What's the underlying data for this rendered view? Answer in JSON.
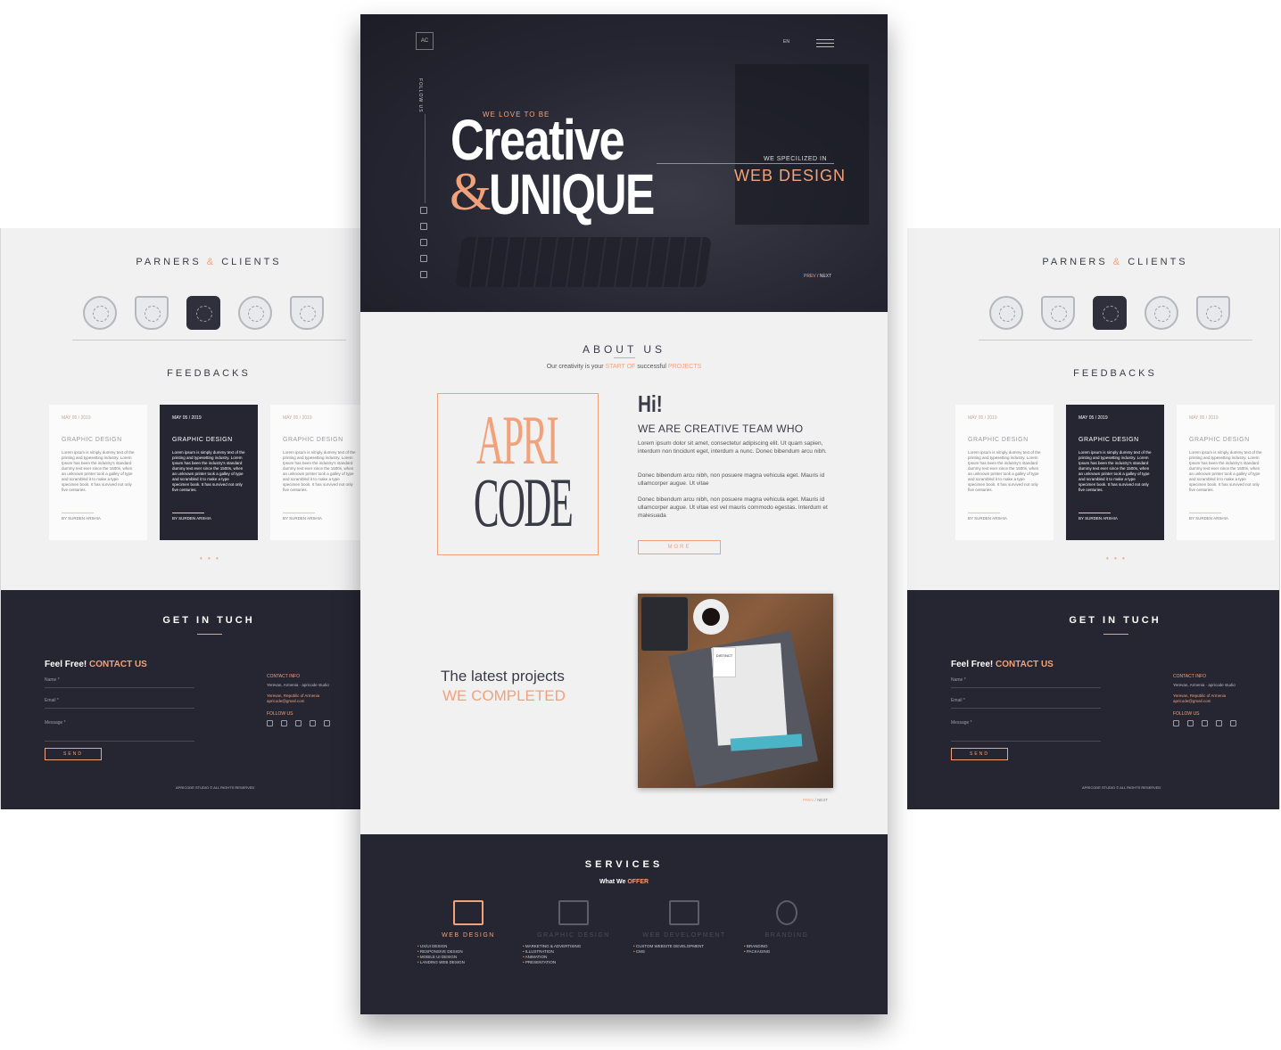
{
  "side": {
    "partners_title": "PARNERS",
    "partners_amp": "&",
    "partners_title2": "CLIENTS",
    "feedbacks_title": "FEEDBACKS",
    "cards": [
      {
        "date": "MAY 05 / 2019",
        "title": "GRAPHIC DESIGN",
        "text": "Lorem ipsum is simply dummy text of the printing and typesetting industry. Lorem Ipsum has been the industry's standard dummy text ever since the 1500s, when an unknown printer took a galley of type and scrambled it to make a type specimen book. It has survived not only five centuries.",
        "author": "BY SURDEN ARSHIA"
      },
      {
        "date": "MAY 05 / 2019",
        "title": "GRAPHIC DESIGN",
        "text": "Lorem ipsum is simply dummy text of the printing and typesetting industry. Lorem Ipsum has been the industry's standard dummy text ever since the 1500s, when an unknown printer took a galley of type and scrambled it to make a type specimen book. It has survived not only five centuries.",
        "author": "BY SURDEN ARSHIA"
      },
      {
        "date": "MAY 05 / 2019",
        "title": "GRAPHIC DESIGN",
        "text": "Lorem ipsum is simply dummy text of the printing and typesetting industry. Lorem Ipsum has been the industry's standard dummy text ever since the 1500s, when an unknown printer took a galley of type and scrambled it to make a type specimen book. It has survived not only five centuries.",
        "author": "BY SURDEN ARSHIA"
      }
    ],
    "dots": "• • •",
    "get_in_touch": "GET IN TUCH",
    "feel_free": "Feel Free!",
    "contact_us": "CONTACT US",
    "name_label": "Name *",
    "email_label": "Email *",
    "message_label": "Message *",
    "send": "SEND",
    "contact_info_label": "CONTACT INFO",
    "contact_info_text": "Yerevan, Armenia · apricode studio",
    "address": "Yerevan, Republic of Armenia",
    "email": "apricode@gmail.com",
    "follow_label": "FOLLOW US",
    "copyright": "APRICODE STUDIO © ALL RIGHTS RESERVED"
  },
  "hero": {
    "logo": "AC",
    "lang": "EN",
    "follow_us": "FOLLOW US",
    "we_love": "WE LOVE TO BE",
    "creative": "Creative",
    "amp": "&",
    "unique": "UNIQUE",
    "we_spec": "WE SPECILIZED IN",
    "web_design": "WEB DESIGN",
    "prev": "PREV",
    "sep": "/",
    "next": "NEXT"
  },
  "about": {
    "title": "ABOUT US",
    "sub_a": "Our creativity is your",
    "sub_b": "START OF",
    "sub_c": "successful",
    "sub_d": "PROJECTS",
    "brand_top": "APRI",
    "brand_bottom": "CODE",
    "hi": "Hi!",
    "team": "WE ARE CREATIVE TEAM WHO",
    "p1": "Lorem ipsum dolor sit amet, consectetur adipiscing elit. Ut quam sapien, interdum non tincidunt eget, interdum a nunc. Donec bibendum arcu nibh.",
    "p2": "Donec bibendum arcu nibh, non posuere magna vehicula eget. Mauris id ullamcorper augue. Ut vitae",
    "p3": "Donec bibendum arcu nibh, non posuere magna vehicula eget. Mauris id ullamcorper augue. Ut vitae est vel mauris commodo egestas. Interdum et malesuada",
    "more": "MORE",
    "latest": "The latest projects",
    "completed": "WE COMPLETED",
    "proj_prev": "PREV",
    "proj_sep": "/",
    "proj_next": "NEXT",
    "distinct": "DISTINCT"
  },
  "services": {
    "title": "SERVICES",
    "sub_a": "What We",
    "sub_b": "OFFER",
    "items": [
      {
        "name": "WEB DESIGN",
        "list": [
          "UX/UI DESIGN",
          "RESPONSIVE DESIGN",
          "MOBILE UI DESIGN",
          "LANDING WEB DESIGN"
        ]
      },
      {
        "name": "GRAPHIC DESIGN",
        "list": [
          "MARKETING & ADVERTISING",
          "ILLUSTRATION",
          "ANIMATION",
          "PRESENTATION"
        ]
      },
      {
        "name": "WEB DEVELOPMENT",
        "list": [
          "CUSTOM WEBSITE DEVELOPMENT",
          "CMS"
        ]
      },
      {
        "name": "BRANDING",
        "list": [
          "BRANDING",
          "PACKAGING"
        ]
      }
    ]
  },
  "colors": {
    "accent": "#f2a27a",
    "dark": "#252632",
    "light": "#f1f1f2"
  }
}
